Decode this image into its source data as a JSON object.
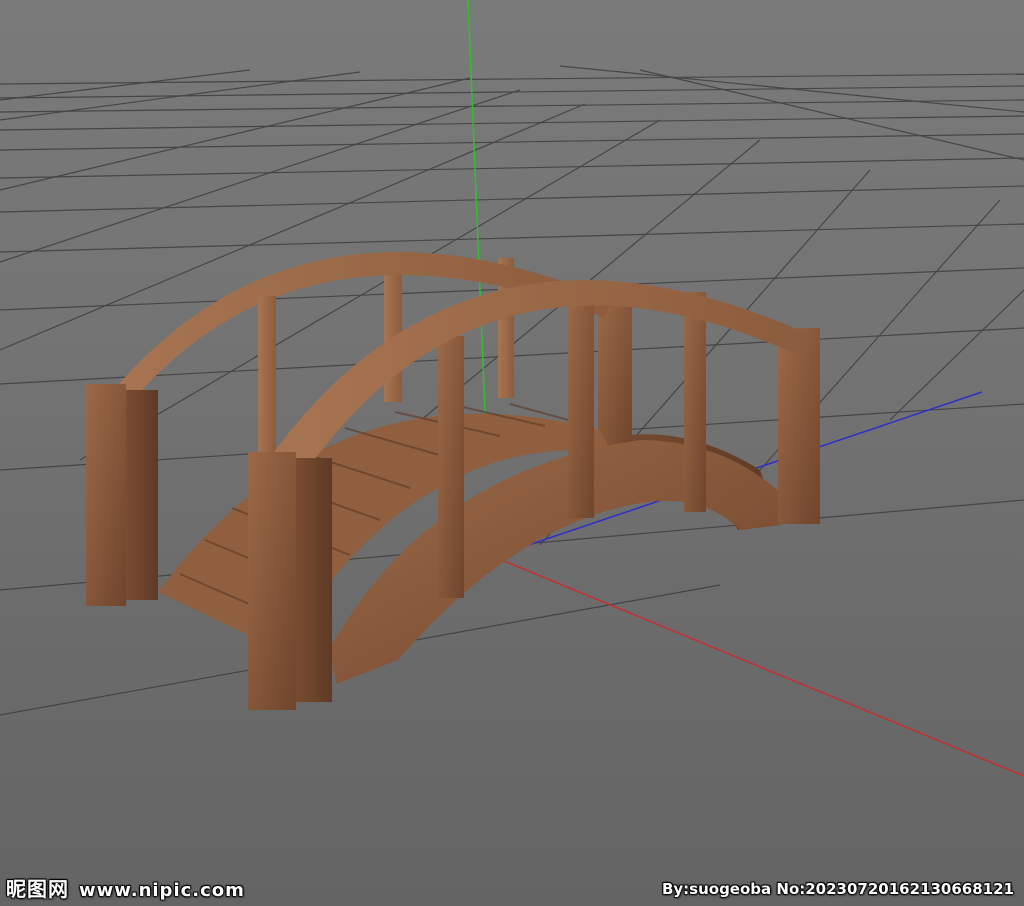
{
  "viewport": {
    "background_color": "#777777",
    "grid_color": "#3c3c3c",
    "axis_colors": {
      "x": "#c43030",
      "y": "#2fbf2f",
      "z": "#2f2fc8"
    },
    "object": "wooden-arched-bridge",
    "wood_color": "#8a5a3a"
  },
  "watermark": {
    "site_name": "昵图网",
    "site_url": "www.nipic.com",
    "author_label": "By:suogeoba",
    "number_label": "No:20230720162130668121"
  }
}
